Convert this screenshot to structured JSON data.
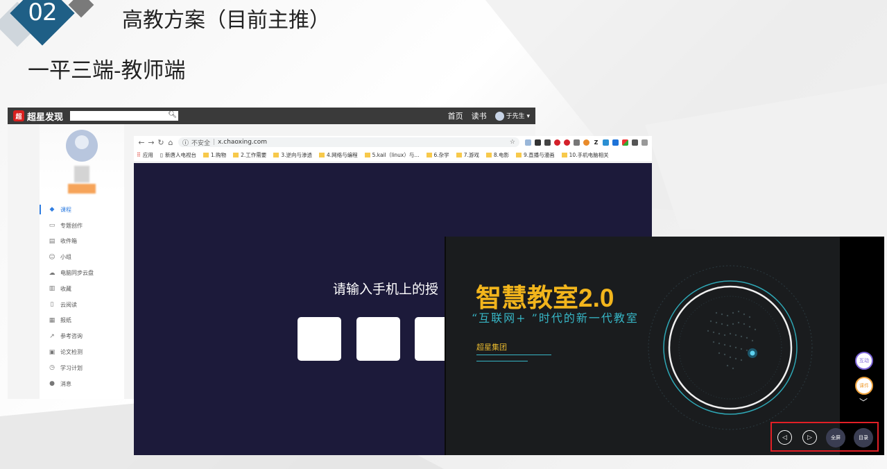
{
  "slide": {
    "number": "02",
    "title": "高教方案（目前主推）",
    "subtitle": "一平三端-教师端"
  },
  "portal": {
    "logo_text": "超星发现",
    "logo_icon": "chaoxing-logo-icon",
    "search_icon": "search-icon",
    "nav": [
      "首页",
      "读书"
    ],
    "user_name": "于先生",
    "menu": [
      {
        "label": "课程",
        "icon": "course-icon",
        "active": true
      },
      {
        "label": "专题创作",
        "icon": "topic-icon"
      },
      {
        "label": "收件箱",
        "icon": "inbox-icon"
      },
      {
        "label": "小组",
        "icon": "group-icon"
      },
      {
        "label": "电脑同步云盘",
        "icon": "cloud-icon"
      },
      {
        "label": "收藏",
        "icon": "bookmark-icon"
      },
      {
        "label": "云阅读",
        "icon": "reading-icon"
      },
      {
        "label": "报纸",
        "icon": "newspaper-icon"
      },
      {
        "label": "参考咨询",
        "icon": "consult-icon"
      },
      {
        "label": "论文检测",
        "icon": "paper-check-icon"
      },
      {
        "label": "学习计划",
        "icon": "clock-icon"
      },
      {
        "label": "消息",
        "icon": "message-icon"
      }
    ]
  },
  "browser": {
    "insecure_label": "不安全",
    "url": "x.chaoxing.com",
    "bookmarks": [
      {
        "label": "应用",
        "type": "apps"
      },
      {
        "label": "新唐人电视台",
        "type": "page"
      },
      {
        "label": "1.购物",
        "type": "folder"
      },
      {
        "label": "2.工作需要",
        "type": "folder"
      },
      {
        "label": "3.逆向与渗透",
        "type": "folder"
      },
      {
        "label": "4.网络与编程",
        "type": "folder"
      },
      {
        "label": "5.kail（linux）与...",
        "type": "folder"
      },
      {
        "label": "6.杂学",
        "type": "folder"
      },
      {
        "label": "7.游戏",
        "type": "folder"
      },
      {
        "label": "8.电影",
        "type": "folder"
      },
      {
        "label": "9.直播与漫画",
        "type": "folder"
      },
      {
        "label": "10.手机电脑相关",
        "type": "folder"
      }
    ],
    "prompt": "请输入手机上的授"
  },
  "classroom": {
    "title": "智慧教室2.0",
    "subtitle": "“互联网+ ”时代的新一代教室",
    "group": "超星集团",
    "side_buttons": [
      "互动",
      "课件"
    ],
    "controls": {
      "prev_icon": "prev-icon",
      "next_icon": "next-icon",
      "fullscreen": "全屏",
      "toc": "目录"
    },
    "colors": {
      "title": "#f2b51c",
      "accent": "#37b7c7",
      "highlight_box": "#e21f26"
    }
  }
}
